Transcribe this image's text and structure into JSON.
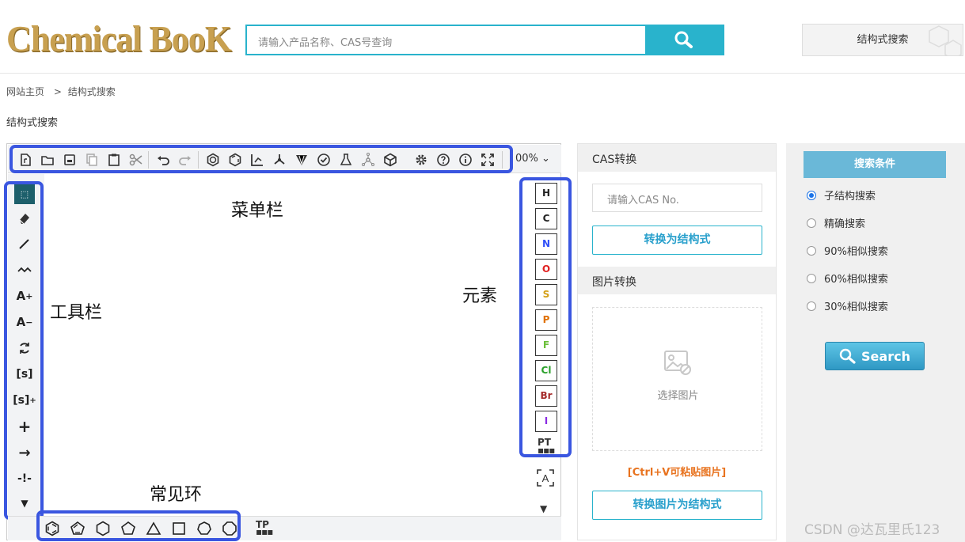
{
  "header": {
    "logo_text": "Chemical BooK",
    "search_placeholder": "请输入产品名称、CAS号查询",
    "structure_search_label": "结构式搜索"
  },
  "breadcrumb": {
    "home": "网站主页",
    "separator": ">",
    "current": "结构式搜索"
  },
  "page_title": "结构式搜索",
  "editor": {
    "zoom_value": "00%",
    "annotations": {
      "menu_bar": "菜单栏",
      "toolbar": "工具栏",
      "elements": "元素",
      "common_rings": "常见环"
    },
    "elements": [
      {
        "symbol": "H",
        "color": "#222222"
      },
      {
        "symbol": "C",
        "color": "#222222"
      },
      {
        "symbol": "N",
        "color": "#3050f8"
      },
      {
        "symbol": "O",
        "color": "#e02020"
      },
      {
        "symbol": "S",
        "color": "#d4a017"
      },
      {
        "symbol": "P",
        "color": "#e07000"
      },
      {
        "symbol": "F",
        "color": "#6bbf3a"
      },
      {
        "symbol": "Cl",
        "color": "#2aa02a"
      },
      {
        "symbol": "Br",
        "color": "#a52a2a"
      },
      {
        "symbol": "I",
        "color": "#8a2be2"
      }
    ],
    "periodic_table_label": "PT",
    "template_label": "TP"
  },
  "cas_panel": {
    "title": "CAS转换",
    "cas_placeholder": "请输入CAS No.",
    "convert_button": "转换为结构式",
    "image_title": "图片转换",
    "select_image": "选择图片",
    "paste_hint": "[Ctrl+V可粘贴图片]",
    "convert_image_button": "转换图片为结构式"
  },
  "search_panel": {
    "title": "搜索条件",
    "options": [
      "子结构搜索",
      "精确搜索",
      "90%相似搜索",
      "60%相似搜索",
      "30%相似搜索"
    ],
    "selected": "子结构搜索",
    "search_button": "Search"
  },
  "watermark": "CSDN @达瓦里氏123"
}
